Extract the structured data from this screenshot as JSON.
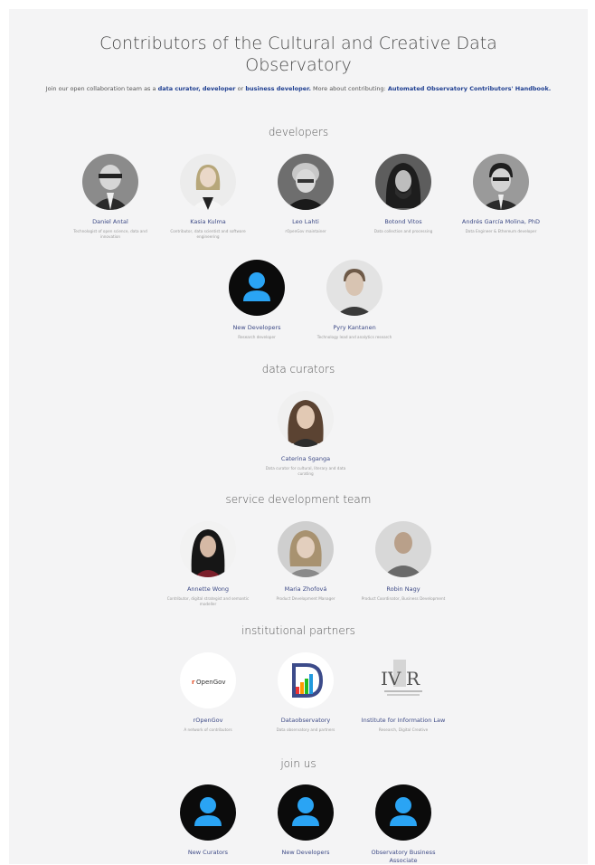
{
  "page": {
    "title": "Contributors of the Cultural and Creative Data Observatory",
    "intro": {
      "t1": "Join our open collaboration team as a",
      "l1": "data curator,",
      "l2": "developer",
      "t2": "or",
      "l3": "business developer.",
      "t3": "More about contributing:",
      "l4": "Automated Observatory Contributors' Handbook."
    }
  },
  "sections": {
    "developers": "developers",
    "curators": "data curators",
    "service": "service development team",
    "partners": "institutional partners",
    "join": "join us"
  },
  "developers": [
    {
      "name": "Daniel Antal",
      "role": "Technologist of open science, data and innovation",
      "icon": "person-photo"
    },
    {
      "name": "Kasia Kulma",
      "role": "Contributor, data scientist and software engineering",
      "icon": "person-photo"
    },
    {
      "name": "Leo Lahti",
      "role": "rOpenGov maintainer",
      "icon": "person-photo"
    },
    {
      "name": "Botond Vitos",
      "role": "Data collection and processing",
      "icon": "person-photo"
    },
    {
      "name": "Andrés García Molina, PhD",
      "role": "Data Engineer & Ethereum developer",
      "icon": "person-photo"
    },
    {
      "name": "New Developers",
      "role": "Research developer",
      "icon": "person-placeholder-icon"
    },
    {
      "name": "Pyry Kantanen",
      "role": "Technology lead and analytics research",
      "icon": "person-photo"
    }
  ],
  "curators": [
    {
      "name": "Caterina Sganga",
      "role": "Data curator for cultural, literary and data curating",
      "icon": "person-photo"
    }
  ],
  "service": [
    {
      "name": "Annette Wong",
      "role": "Contributor, digital strategist and semantic modeller",
      "icon": "person-photo"
    },
    {
      "name": "Maria Zhofová",
      "role": "Product Development Manager",
      "icon": "person-photo"
    },
    {
      "name": "Robin Nagy",
      "role": "Product Coordinator, Business Development",
      "icon": "person-photo"
    }
  ],
  "partners": [
    {
      "name": "rOpenGov",
      "role": "A network of contributors",
      "icon": "ropengov-logo"
    },
    {
      "name": "Dataobservatory",
      "role": "Data observatory and partners",
      "icon": "dataobservatory-logo"
    },
    {
      "name": "Institute for Information Law",
      "role": "Research, Digital Creative",
      "icon": "ivir-logo"
    }
  ],
  "join": [
    {
      "name": "New Curators",
      "icon": "person-placeholder-icon"
    },
    {
      "name": "New Developers",
      "icon": "person-placeholder-icon"
    },
    {
      "name": "Observatory Business Associate",
      "icon": "person-placeholder-icon"
    }
  ],
  "colors": {
    "background": "#f4f4f5",
    "link": "#1f3f91",
    "name": "#3d4a86",
    "placeholder_bg": "#0b0b0b",
    "placeholder_fg": "#2aa4f4"
  }
}
